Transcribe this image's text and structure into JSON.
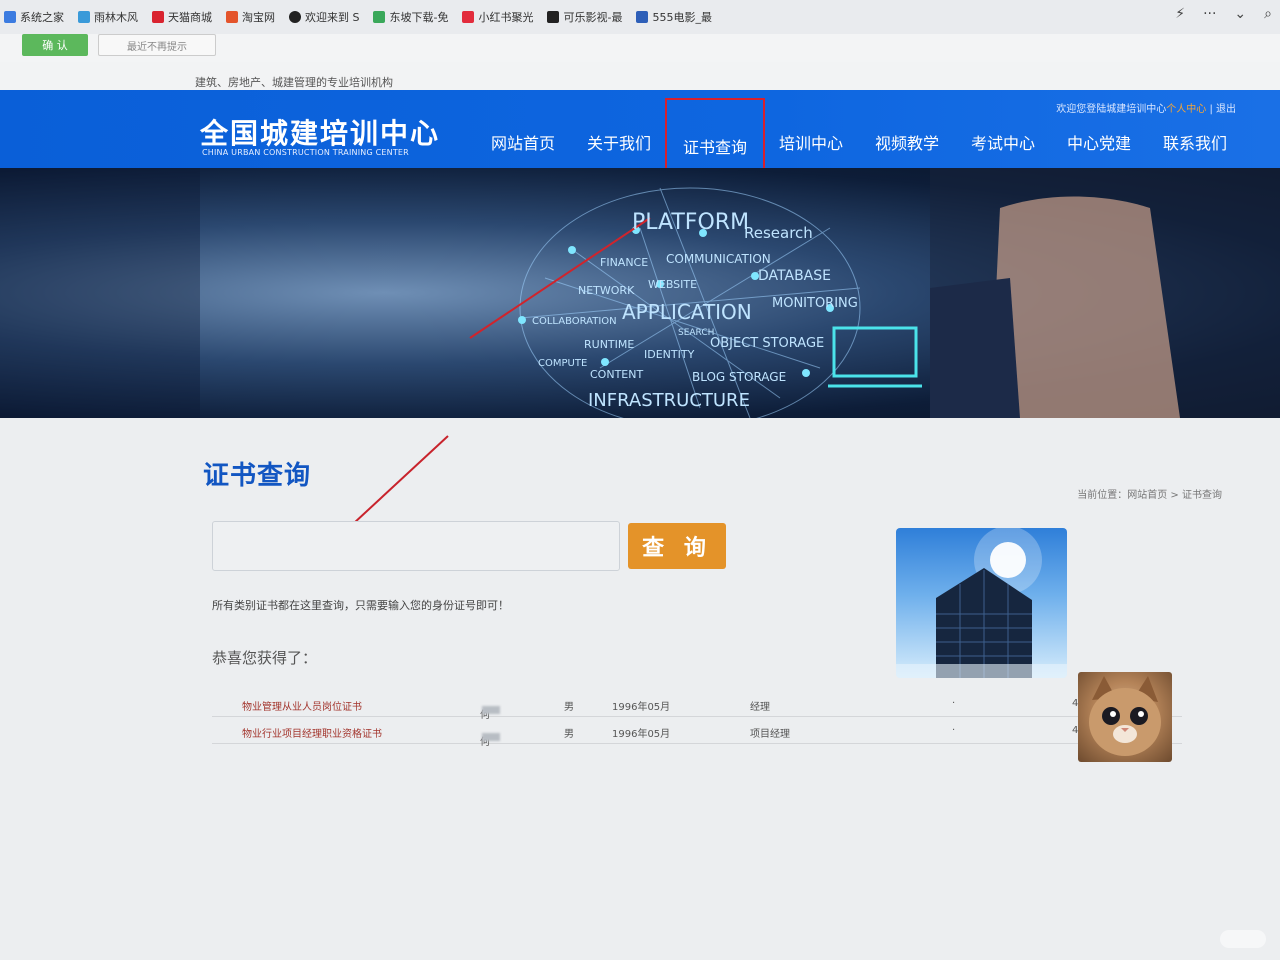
{
  "browser": {
    "bookmarks": [
      {
        "label": "系统之家",
        "color": "#3b7be0"
      },
      {
        "label": "雨林木风",
        "color": "#3a9ad9"
      },
      {
        "label": "天猫商城",
        "color": "#d9232f"
      },
      {
        "label": "淘宝网",
        "color": "#e4542b"
      },
      {
        "label": "欢迎来到 S",
        "color": "#222222"
      },
      {
        "label": "东坡下载-免",
        "color": "#3aa85a"
      },
      {
        "label": "小红书聚光",
        "color": "#e22c3c"
      },
      {
        "label": "可乐影视-最",
        "color": "#222222"
      },
      {
        "label": "555电影_最",
        "color": "#2e5fb8"
      }
    ],
    "tools": [
      "⚡",
      "···",
      "⌄",
      "⌕"
    ]
  },
  "notice": {
    "confirm_label": "确 认",
    "dismiss_label": "最近不再提示"
  },
  "site": {
    "tagline": "建筑、房地产、城建管理的专业培训机构",
    "welcome_prefix": "欢迎您登陆城建培训中心",
    "welcome_personal": "个人中心",
    "welcome_sep": " | ",
    "welcome_logout": "退出",
    "logo_cn": "全国城建培训中心",
    "logo_en": "CHINA URBAN CONSTRUCTION TRAINING CENTER",
    "nav": [
      {
        "label": "网站首页",
        "active": false
      },
      {
        "label": "关于我们",
        "active": false
      },
      {
        "label": "证书查询",
        "active": true
      },
      {
        "label": "培训中心",
        "active": false
      },
      {
        "label": "视频教学",
        "active": false
      },
      {
        "label": "考试中心",
        "active": false
      },
      {
        "label": "中心党建",
        "active": false
      },
      {
        "label": "联系我们",
        "active": false
      }
    ]
  },
  "banner": {
    "words": [
      "PLATFORM",
      "Research",
      "FINANCE",
      "COMMUNICATION",
      "DATABASE",
      "NETWORK",
      "WEBSITE",
      "COLLABORATION",
      "APPLICATION",
      "MONITORING",
      "SEARCH",
      "RUNTIME",
      "IDENTITY",
      "OBJECT STORAGE",
      "COMPUTE",
      "CONTENT",
      "BLOG STORAGE",
      "INFRASTRUCTURE"
    ]
  },
  "main": {
    "title": "证书查询",
    "breadcrumb": "当前位置：网站首页 > 证书查询",
    "search_value": "",
    "search_button": "查 询",
    "hint": "所有类别证书都在这里查询，只需要输入您的身份证号即可！",
    "congrats": "恭喜您获得了："
  },
  "certificates": [
    {
      "name": "物业管理从业人员岗位证书",
      "holder": "何",
      "gender": "男",
      "birth": "1996年05月",
      "position": "经理",
      "mark": "·",
      "number": "4"
    },
    {
      "name": "物业行业项目经理职业资格证书",
      "holder": "何",
      "gender": "男",
      "birth": "1996年05月",
      "position": "项目经理",
      "mark": "·",
      "number": "4"
    }
  ]
}
